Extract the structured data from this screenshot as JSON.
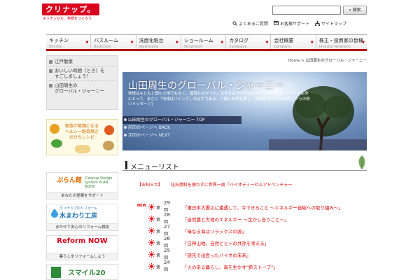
{
  "header": {
    "logo_text": "クリナップ。",
    "tagline": "キッチンから、笑顔をつくろう",
    "search_button": "検索",
    "util_links": [
      "よくあるご質問",
      "お客様サポート",
      "サイトマップ"
    ]
  },
  "nav": [
    {
      "ja": "キッチン",
      "en": "Kitchen"
    },
    {
      "ja": "バスルーム",
      "en": "Bathroom"
    },
    {
      "ja": "洗面化粧台",
      "en": "Washstand"
    },
    {
      "ja": "ショールーム",
      "en": "Showroom"
    },
    {
      "ja": "カタログ",
      "en": "Catalogue"
    },
    {
      "ja": "会社概要",
      "en": "Company"
    },
    {
      "ja": "株主・投資家の皆様",
      "en": "Investor Relations"
    }
  ],
  "sidebar": {
    "items": [
      "江戸散策",
      "おいしい時間（とき）を\nすごしましょう！",
      "山田周生の\nグローバル・ジャーニー"
    ],
    "recipe_banner": "家族が笑顔になる\nヘルシー野菜焼き\nおせちレシピ",
    "banners": [
      {
        "title": "ぷらん館",
        "sub": "Cleanup Design System PLAN BOOK",
        "caption": "あなたの提案をサポート"
      },
      {
        "title": "水まわり工房",
        "sub": "クリナップのリフォーム",
        "caption": "まかせて安心のリフォーム相談"
      },
      {
        "title": "Reform NOW",
        "sub": "",
        "caption": "暮らしをリフォームしよう"
      },
      {
        "title": "スマイル20",
        "sub": "",
        "caption": ""
      }
    ]
  },
  "breadcrumb": "Home > 山田周生のグローバル・ジャーニー",
  "hero": {
    "title": "山田周生のグローバル・ジャーニー",
    "desc": "地球はもともと国も土地でもなく、国境もなかった。生あるものの存在は自然であり自然にすべての生命にとって、まさに「地球はリビング」のはずである。人間と自然を愛し、[地球を旅する山田周生からの熱いメッセージ]",
    "links": [
      "山田周生のグローバル・ジャーニー TOP",
      "前回のページへ BACK",
      "次回のページへ NEXT"
    ]
  },
  "section_title": "メニューリスト",
  "notice": {
    "label": "【お知らせ】",
    "text": "化石燃料を使わずに世界一周「バイオディーゼルアドベンチャー"
  },
  "colors": {
    "brand_red": "#d8001c",
    "accent_red": "#cc0000"
  },
  "episodes": [
    {
      "new": "NEW",
      "pre": "第",
      "num": "29",
      "post": "回",
      "title": "「東日本大震災に遭遇して、今できること ～エネルギー自給への取り組み～」"
    },
    {
      "new": "",
      "pre": "第",
      "num": "28",
      "post": "回",
      "title": "「自然農と大地のエネルギー ～生かし合うこと～」"
    },
    {
      "new": "",
      "pre": "第",
      "num": "27",
      "post": "回",
      "title": "「母なる海はリラックスの源」"
    },
    {
      "new": "",
      "pre": "第",
      "num": "26",
      "post": "回",
      "title": "「白神山地。自然とヒトの共存を考える」"
    },
    {
      "new": "",
      "pre": "第",
      "num": "25",
      "post": "回",
      "title": "「旅先で出会ったバイオの未来」"
    },
    {
      "new": "",
      "pre": "第",
      "num": "24",
      "post": "回",
      "title": "「火のある暮らし、森を生かす\"薪ストーブ\"」"
    }
  ]
}
